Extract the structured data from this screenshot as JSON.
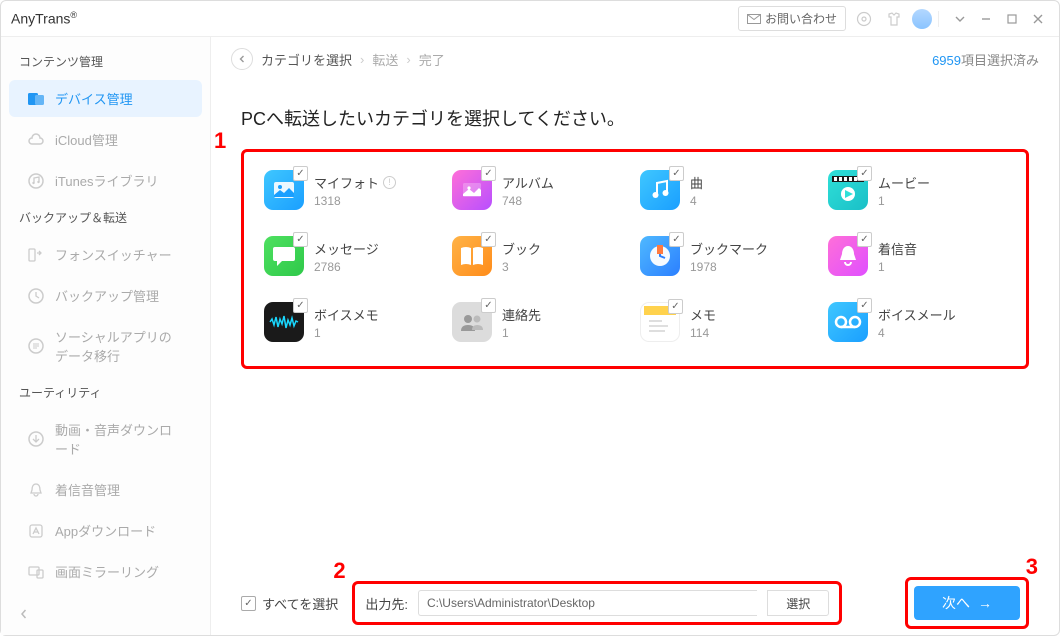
{
  "app": {
    "name": "AnyTrans",
    "reg": "®"
  },
  "titlebar": {
    "contact": "お問い合わせ"
  },
  "sidebar": {
    "sections": [
      {
        "title": "コンテンツ管理",
        "items": [
          {
            "id": "device",
            "label": "デバイス管理",
            "active": true
          },
          {
            "id": "icloud",
            "label": "iCloud管理"
          },
          {
            "id": "itunes",
            "label": "iTunesライブラリ"
          }
        ]
      },
      {
        "title": "バックアップ＆転送",
        "items": [
          {
            "id": "phoneswitcher",
            "label": "フォンスイッチャー"
          },
          {
            "id": "backup",
            "label": "バックアップ管理"
          },
          {
            "id": "social",
            "label": "ソーシャルアプリのデータ移行"
          }
        ]
      },
      {
        "title": "ユーティリティ",
        "items": [
          {
            "id": "download",
            "label": "動画・音声ダウンロード"
          },
          {
            "id": "ringtonemgr",
            "label": "着信音管理"
          },
          {
            "id": "appdownload",
            "label": "Appダウンロード"
          },
          {
            "id": "mirror",
            "label": "画面ミラーリング"
          }
        ]
      }
    ]
  },
  "breadcrumb": {
    "items": [
      "カテゴリを選択",
      "転送",
      "完了"
    ],
    "status_count": "6959",
    "status_suffix": "項目選択済み"
  },
  "heading": "PCへ転送したいカテゴリを選択してください。",
  "categories": [
    {
      "name": "マイフォト",
      "count": "1318",
      "icon": "ic-photos",
      "info": true
    },
    {
      "name": "アルバム",
      "count": "748",
      "icon": "ic-album"
    },
    {
      "name": "曲",
      "count": "4",
      "icon": "ic-music"
    },
    {
      "name": "ムービー",
      "count": "1",
      "icon": "ic-movie"
    },
    {
      "name": "メッセージ",
      "count": "2786",
      "icon": "ic-message"
    },
    {
      "name": "ブック",
      "count": "3",
      "icon": "ic-book"
    },
    {
      "name": "ブックマーク",
      "count": "1978",
      "icon": "ic-bookmark"
    },
    {
      "name": "着信音",
      "count": "1",
      "icon": "ic-ringtone"
    },
    {
      "name": "ボイスメモ",
      "count": "1",
      "icon": "ic-voicememo"
    },
    {
      "name": "連絡先",
      "count": "1",
      "icon": "ic-contacts"
    },
    {
      "name": "メモ",
      "count": "114",
      "icon": "ic-notes"
    },
    {
      "name": "ボイスメール",
      "count": "4",
      "icon": "ic-voicemail"
    }
  ],
  "footer": {
    "select_all": "すべてを選択",
    "output_label": "出力先:",
    "output_path": "C:\\Users\\Administrator\\Desktop",
    "choose": "選択",
    "next": "次へ"
  },
  "annotations": {
    "n1": "1",
    "n2": "2",
    "n3": "3"
  }
}
